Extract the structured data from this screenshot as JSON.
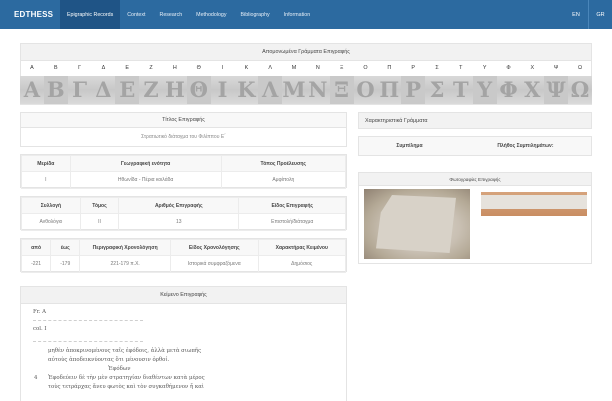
{
  "app": {
    "brand": "EDTHESS"
  },
  "nav": [
    {
      "label": "Epigraphic Records",
      "active": true
    },
    {
      "label": "Context"
    },
    {
      "label": "Research"
    },
    {
      "label": "Methodology"
    },
    {
      "label": "Bibliography"
    },
    {
      "label": "Information"
    }
  ],
  "lang": [
    "EN",
    "GR"
  ],
  "alphabet": {
    "title": "Απομονωμένα Γράμματα Επιγραφής",
    "letters": [
      "Α",
      "Β",
      "Γ",
      "Δ",
      "Ε",
      "Ζ",
      "Η",
      "Θ",
      "Ι",
      "Κ",
      "Λ",
      "Μ",
      "Ν",
      "Ξ",
      "Ο",
      "Π",
      "Ρ",
      "Σ",
      "Τ",
      "Υ",
      "Φ",
      "Χ",
      "Ψ",
      "Ω"
    ]
  },
  "title_section": {
    "label": "Τίτλος Επιγραφής",
    "value": "Στρατιωτικό διάταγμα του Φιλίππου Ε΄"
  },
  "location": {
    "headers": [
      "Μερίδα",
      "Γεωγραφική ενότητα",
      "Τόπος Προέλευσης"
    ],
    "values": [
      "Ι",
      "Ηθωνίδα - Πέρια κοιλάδα",
      "Αμφίπολη"
    ]
  },
  "collection": {
    "headers": [
      "Συλλογή",
      "Τόμος",
      "Αριθμός Επιγραφής",
      "Είδος Επιγραφής"
    ],
    "values": [
      "Ανθολόγιο",
      "ΙΙ",
      "13",
      "Επιστολή/διάταγμα"
    ]
  },
  "dating": {
    "headers": [
      "από",
      "έως",
      "Περιγραφική Χρονολόγηση",
      "Είδος Χρονολόγησης",
      "Χαρακτήρας Κειμένου"
    ],
    "values": [
      "-221",
      "-179",
      "221-179 π.Χ.",
      "Ιστορικά συμφραζόμενα",
      "Δημόσιος"
    ]
  },
  "characteristic": {
    "label": "Χαρακτηριστικά Γράμματα",
    "col1": "Συμπίλημα",
    "col2": "Πλήθος Συμπιλημάτων:"
  },
  "photos": {
    "label": "Φωτογραφίες Επιγραφής"
  },
  "text_section": {
    "label": "Κείμενο Επιγραφής",
    "fragment": "Fr. A",
    "column": "col. I",
    "lines": [
      {
        "num": "",
        "text": "μηθὲν ἀποκρινομένους ταῖς ἐφόδοις, ἀλλὰ μετὰ σιωπῆς"
      },
      {
        "num": "",
        "text": "αὐτοὺς ἀποδεικνύοντας ὅτι μένουσιν ὀρθοί."
      },
      {
        "num": "",
        "text": "Ἐφόδων"
      },
      {
        "num": "4",
        "text": "Ἐφοδεύειν δὲ τὴν μὲν στρατηγίαν διαθέντων κατὰ μέρος"
      },
      {
        "num": "",
        "text": "τοὺς τετράρχας ἄνευ φωτὸς καὶ τὸν συγκαθήμενον ἤ καὶ"
      }
    ]
  }
}
